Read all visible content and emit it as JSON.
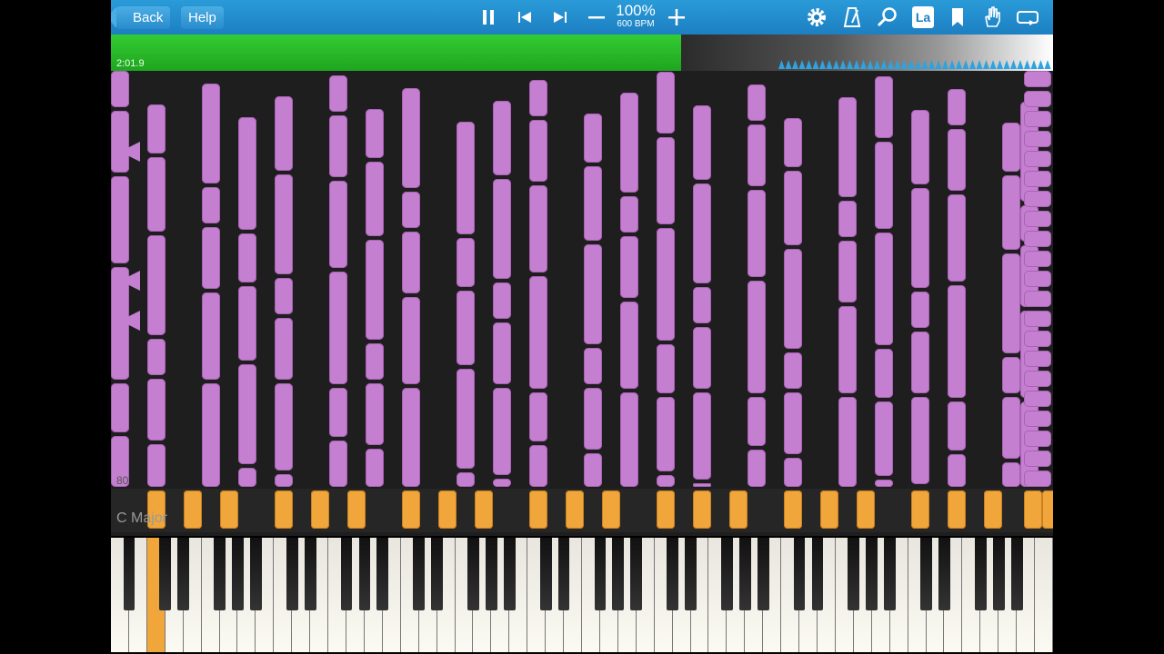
{
  "toolbar": {
    "back_label": "Back",
    "help_label": "Help",
    "tempo_percent": "100%",
    "tempo_bpm": "600 BPM",
    "icons": [
      "pause-icon",
      "skip-back-icon",
      "skip-forward-icon",
      "minus-icon",
      "plus-icon",
      "gear-icon",
      "metronome-icon",
      "search-icon",
      "label-icon",
      "bookmark-icon",
      "hand-icon",
      "loop-icon"
    ],
    "label_button_text": "La"
  },
  "progress": {
    "elapsed": "2:01.9",
    "fraction": 0.605
  },
  "roll": {
    "key_signature": "C Major",
    "measure_number": "80"
  },
  "colors": {
    "toolbar": "#1c7fc2",
    "note": "#c57fd0",
    "active_note": "#f0a63a",
    "progress": "#33cc33"
  }
}
